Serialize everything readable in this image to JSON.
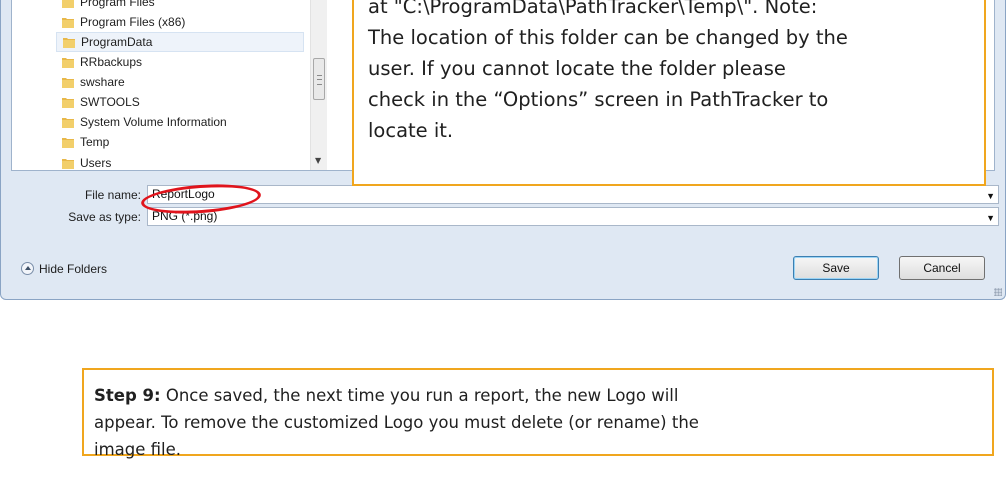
{
  "folder_tree": {
    "items": [
      {
        "label": "Program Files",
        "selected": false
      },
      {
        "label": "Program Files (x86)",
        "selected": false
      },
      {
        "label": "ProgramData",
        "selected": true
      },
      {
        "label": "RRbackups",
        "selected": false
      },
      {
        "label": "swshare",
        "selected": false
      },
      {
        "label": "SWTOOLS",
        "selected": false
      },
      {
        "label": "System Volume Information",
        "selected": false
      },
      {
        "label": "Temp",
        "selected": false
      },
      {
        "label": "Users",
        "selected": false
      }
    ],
    "icon": "folder-icon",
    "folder_color": "#e8b84a"
  },
  "callout": {
    "lines": [
      "at \"C:\\ProgramData\\PathTracker\\Temp\\\". Note:",
      "The location of this folder can be changed by the",
      "user.  If you cannot locate the folder  please",
      "check in the “Options” screen in PathTracker to",
      "locate it."
    ],
    "border_color": "#f0a61e"
  },
  "save_form": {
    "file_name_label": "File name:",
    "file_name_value": "ReportLogo",
    "save_type_label": "Save as type:",
    "save_type_value": "PNG (*.png)"
  },
  "buttons": {
    "hide_folders": "Hide Folders",
    "save": "Save",
    "cancel": "Cancel"
  },
  "highlight": {
    "color": "#e0141c",
    "shape": "ellipse around file name"
  },
  "step9": {
    "heading": "Step 9:",
    "lines": [
      " Once saved, the next time you run a report, the new Logo will",
      "appear.  To remove the customized Logo you must delete (or rename) the",
      "image file."
    ]
  }
}
